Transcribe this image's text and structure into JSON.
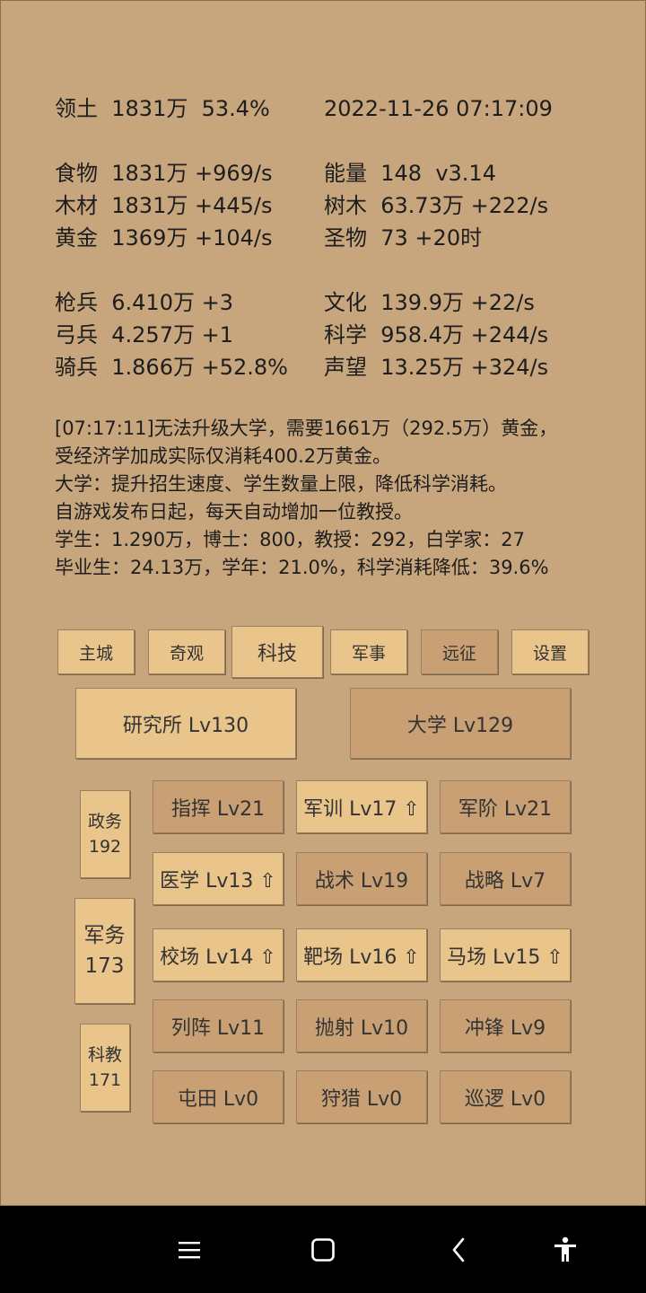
{
  "stats": {
    "territory_label": "领土",
    "territory_value": "1831万  53.4%",
    "datetime": "2022-11-26 07:17:09",
    "food_label": "食物",
    "food_value": "1831万 +969/s",
    "energy_label": "能量",
    "energy_value": "148  v3.14",
    "wood_label": "木材",
    "wood_value": "1831万 +445/s",
    "trees_label": "树木",
    "trees_value": "63.73万 +222/s",
    "gold_label": "黄金",
    "gold_value": "1369万 +104/s",
    "relic_label": "圣物",
    "relic_value": "73 +20时",
    "spear_label": "枪兵",
    "spear_value": "6.410万 +3",
    "culture_label": "文化",
    "culture_value": "139.9万 +22/s",
    "archer_label": "弓兵",
    "archer_value": "4.257万 +1",
    "science_label": "科学",
    "science_value": "958.4万 +244/s",
    "cavalry_label": "骑兵",
    "cavalry_value": "1.866万 +52.8%",
    "prestige_label": "声望",
    "prestige_value": "13.25万 +324/s"
  },
  "log": [
    "[07:17:11]无法升级大学，需要1661万（292.5万）黄金，",
    "受经济学加成实际仅消耗400.2万黄金。",
    "大学：提升招生速度、学生数量上限，降低科学消耗。",
    "自游戏发布日起，每天自动增加一位教授。",
    "学生：1.290万，博士：800，教授：292，白学家：27",
    "毕业生：24.13万，学年：21.0%，科学消耗降低：39.6%"
  ],
  "tabs": [
    "主城",
    "奇观",
    "科技",
    "军事",
    "远征",
    "设置"
  ],
  "buildings": [
    "研究所 Lv130",
    "大学 Lv129"
  ],
  "categories": [
    {
      "name": "政务",
      "count": "192"
    },
    {
      "name": "军务",
      "count": "173"
    },
    {
      "name": "科教",
      "count": "171"
    }
  ],
  "techs": [
    "指挥 Lv21",
    "军训 Lv17 ⇧",
    "军阶 Lv21",
    "医学 Lv13 ⇧",
    "战术 Lv19",
    "战略 Lv7",
    "校场 Lv14 ⇧",
    "靶场 Lv16 ⇧",
    "马场 Lv15 ⇧",
    "列阵 Lv11",
    "抛射 Lv10",
    "冲锋 Lv9",
    "屯田 Lv0",
    "狩猎 Lv0",
    "巡逻 Lv0"
  ],
  "icons": {
    "menu": "menu-icon",
    "home": "home-icon",
    "back": "back-icon",
    "accessibility": "accessibility-icon"
  }
}
